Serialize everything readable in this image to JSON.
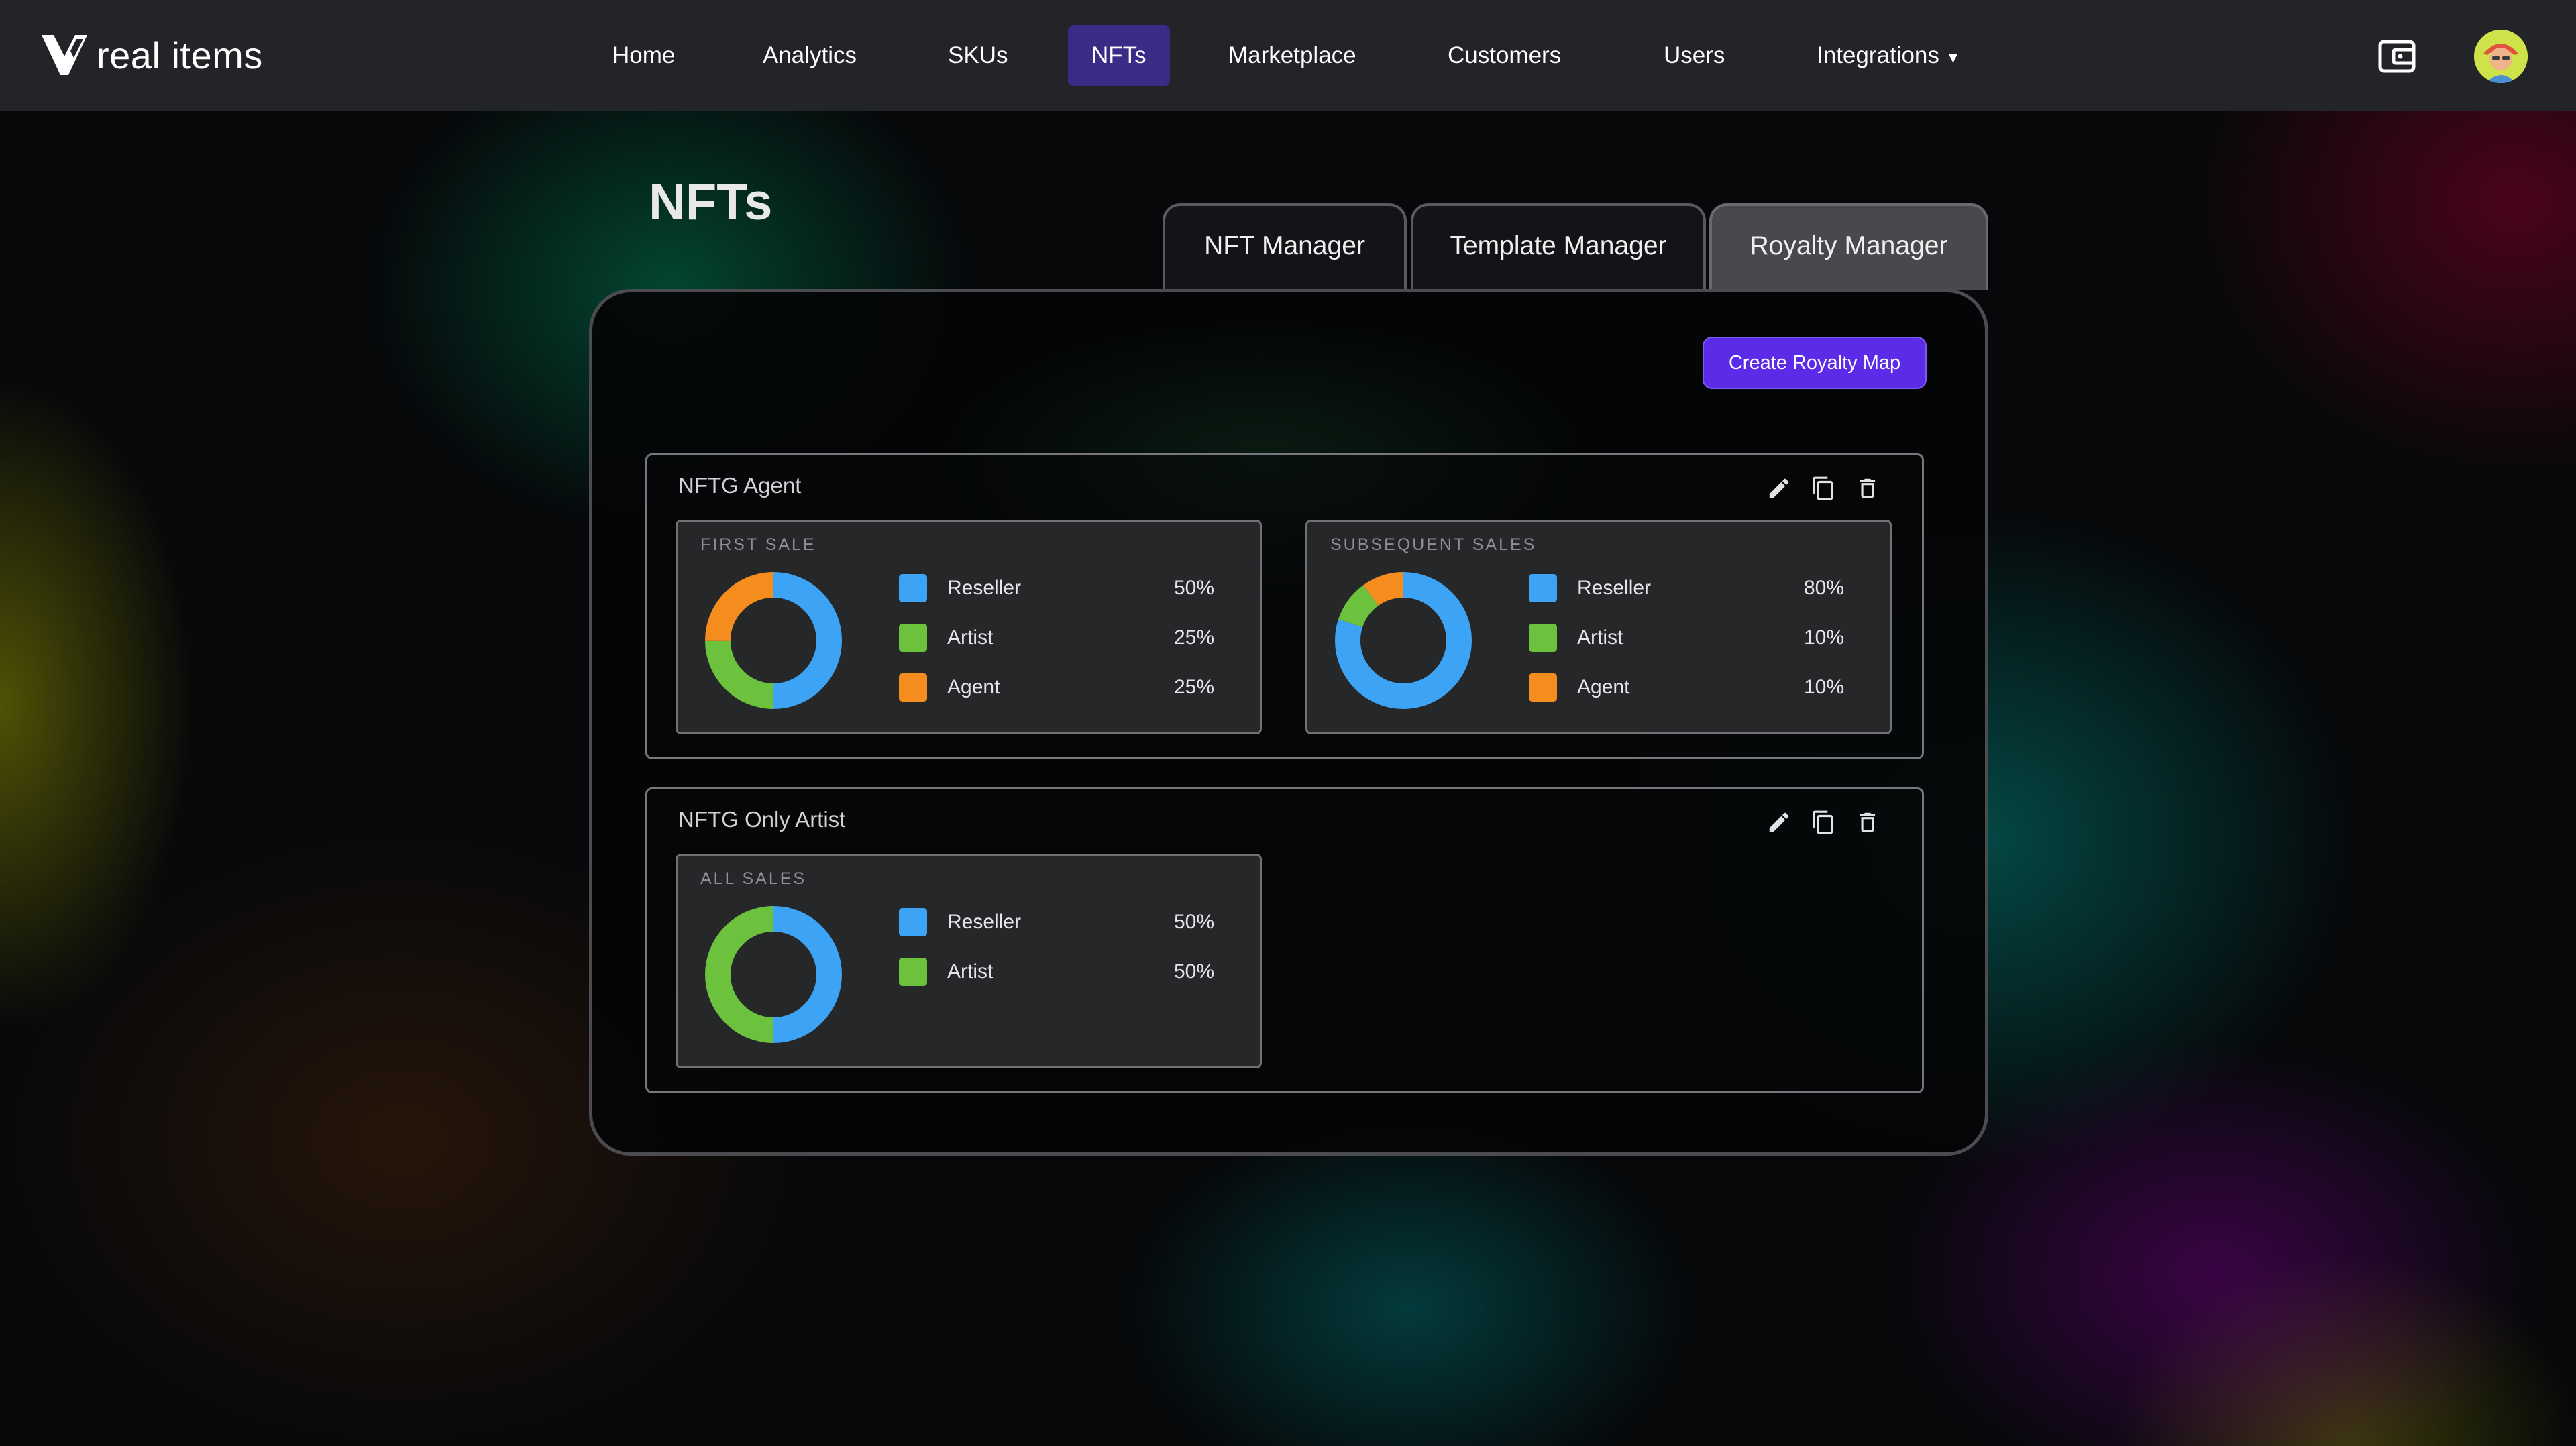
{
  "brand": {
    "name": "real items"
  },
  "nav": {
    "items": [
      {
        "label": "Home"
      },
      {
        "label": "Analytics"
      },
      {
        "label": "SKUs"
      },
      {
        "label": "NFTs",
        "active": true
      },
      {
        "label": "Marketplace"
      },
      {
        "label": "Customers"
      },
      {
        "label": "Users"
      },
      {
        "label": "Integrations",
        "caret": "▾"
      }
    ]
  },
  "header_icons": {
    "wallet": "wallet-icon",
    "avatar": "user-avatar"
  },
  "page": {
    "title": "NFTs"
  },
  "tabs": [
    {
      "label": "NFT Manager"
    },
    {
      "label": "Template Manager"
    },
    {
      "label": "Royalty Manager",
      "active": true
    }
  ],
  "actions": {
    "create_label": "Create Royalty Map"
  },
  "colors": {
    "reseller": "#3da4f5",
    "artist": "#6cc23c",
    "agent": "#f58d1e",
    "accent": "#5b2be8",
    "nav_active": "#3b2a86"
  },
  "royalty_maps": [
    {
      "name": "NFTG Agent",
      "icons": [
        "edit-icon",
        "copy-icon",
        "delete-icon"
      ],
      "shares": [
        {
          "label": "FIRST SALE",
          "entries": [
            {
              "role": "Reseller",
              "percent": "50%",
              "value": 50
            },
            {
              "role": "Artist",
              "percent": "25%",
              "value": 25
            },
            {
              "role": "Agent",
              "percent": "25%",
              "value": 25
            }
          ]
        },
        {
          "label": "SUBSEQUENT SALES",
          "entries": [
            {
              "role": "Reseller",
              "percent": "80%",
              "value": 80
            },
            {
              "role": "Artist",
              "percent": "10%",
              "value": 10
            },
            {
              "role": "Agent",
              "percent": "10%",
              "value": 10
            }
          ]
        }
      ]
    },
    {
      "name": "NFTG Only Artist",
      "icons": [
        "edit-icon",
        "copy-icon",
        "delete-icon"
      ],
      "shares": [
        {
          "label": "ALL SALES",
          "entries": [
            {
              "role": "Reseller",
              "percent": "50%",
              "value": 50
            },
            {
              "role": "Artist",
              "percent": "50%",
              "value": 50
            }
          ]
        }
      ]
    }
  ]
}
